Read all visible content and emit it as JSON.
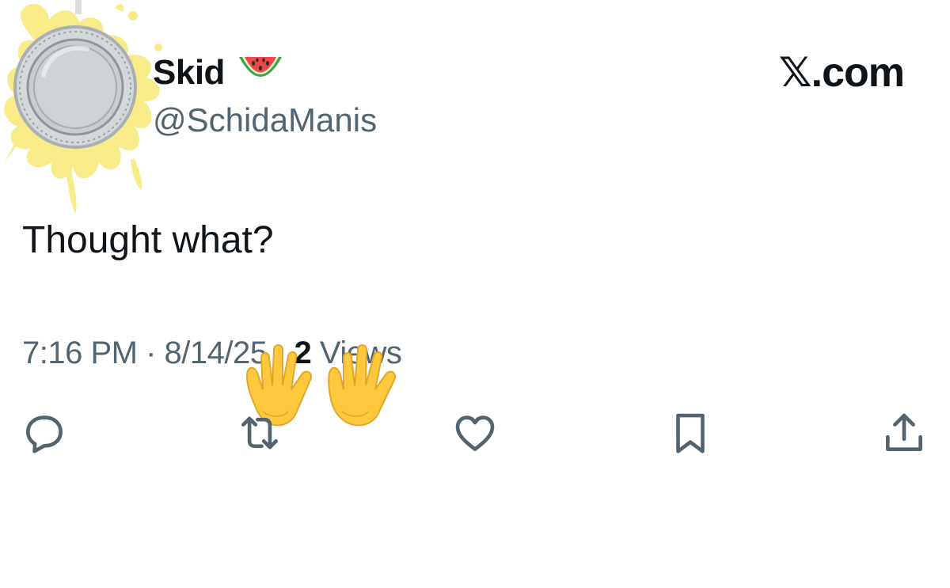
{
  "tweet": {
    "display_name": "Skid",
    "display_name_emoji": "watermelon",
    "handle": "@SchidaManis",
    "site_mark": "𝕏.com",
    "text": "Thought what?",
    "meta": {
      "time": "7:16 PM",
      "separator": " · ",
      "date": "8/14/25",
      "views_count": "2",
      "views_label": " Views"
    },
    "overlay_emoji": "raising-hands",
    "avatar_icon": "coin-with-yellow-splash",
    "actions": [
      {
        "name": "reply",
        "icon": "speech-bubble-icon"
      },
      {
        "name": "repost",
        "icon": "repost-arrows-icon"
      },
      {
        "name": "like",
        "icon": "heart-icon"
      },
      {
        "name": "bookmark",
        "icon": "bookmark-icon"
      },
      {
        "name": "share",
        "icon": "share-upload-icon"
      }
    ]
  },
  "colors": {
    "text_primary": "#0f1419",
    "text_secondary": "#536471",
    "icon_gray": "#536471",
    "splash_yellow": "#f8ec85",
    "coin_silver": "#c8cdd0"
  }
}
